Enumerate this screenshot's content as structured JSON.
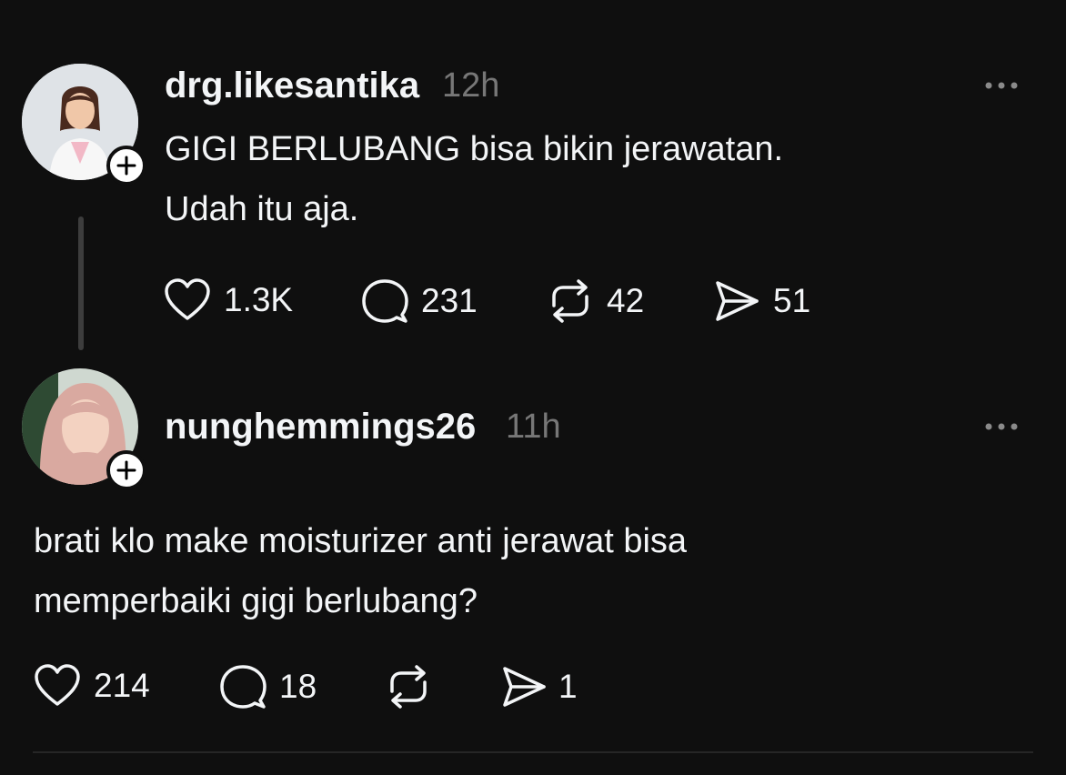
{
  "posts": [
    {
      "username": "drg.likesantika",
      "time": "12h",
      "text_lines": [
        "GIGI BERLUBANG bisa bikin jerawatan.",
        "Udah itu aja."
      ],
      "likes": "1.3K",
      "replies": "231",
      "reposts": "42",
      "shares": "51"
    },
    {
      "username": "nunghemmings26",
      "time": "11h",
      "text_lines": [
        "brati klo make moisturizer anti jerawat bisa",
        "memperbaiki gigi berlubang?"
      ],
      "likes": "214",
      "replies": "18",
      "reposts": "",
      "shares": "1"
    }
  ],
  "icons": {
    "like": "heart-icon",
    "reply": "comment-icon",
    "repost": "repost-icon",
    "share": "send-icon",
    "more": "more-icon",
    "follow": "plus-icon"
  },
  "colors": {
    "background": "#0f0f0f",
    "text": "#f3f5f7",
    "muted": "#777777",
    "thread_line": "#3d3d3d"
  }
}
